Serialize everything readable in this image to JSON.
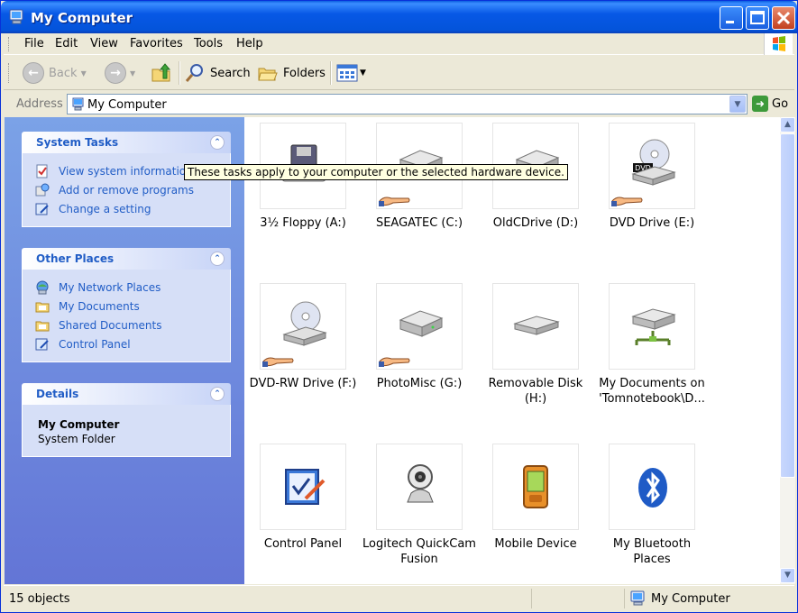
{
  "window": {
    "title": "My Computer"
  },
  "menu": {
    "items": [
      "File",
      "Edit",
      "View",
      "Favorites",
      "Tools",
      "Help"
    ]
  },
  "toolbar": {
    "back": "Back",
    "search": "Search",
    "folders": "Folders"
  },
  "address": {
    "label": "Address",
    "value": "My Computer",
    "go": "Go"
  },
  "system_tasks": {
    "title": "System Tasks",
    "items": [
      "View system information",
      "Add or remove programs",
      "Change a setting"
    ]
  },
  "other_places": {
    "title": "Other Places",
    "items": [
      "My Network Places",
      "My Documents",
      "Shared Documents",
      "Control Panel"
    ]
  },
  "details": {
    "title": "Details",
    "name": "My Computer",
    "type": "System Folder"
  },
  "tooltip": "These tasks apply to your computer or the selected hardware device.",
  "items": [
    {
      "label": "3½ Floppy (A:)",
      "icon": "floppy-drive-icon"
    },
    {
      "label": "SEAGATEC (C:)",
      "icon": "hard-drive-icon"
    },
    {
      "label": "OldCDrive (D:)",
      "icon": "hard-drive-icon"
    },
    {
      "label": "DVD Drive (E:)",
      "icon": "dvd-drive-icon"
    },
    {
      "label": "DVD-RW Drive (F:)",
      "icon": "dvd-drive-icon"
    },
    {
      "label": "PhotoMisc (G:)",
      "icon": "hard-drive-icon"
    },
    {
      "label": "Removable Disk (H:)",
      "icon": "removable-disk-icon"
    },
    {
      "label": "My Documents on 'Tomnotebook\\D...",
      "icon": "network-drive-icon"
    },
    {
      "label": "Control Panel",
      "icon": "control-panel-icon"
    },
    {
      "label": "Logitech QuickCam Fusion",
      "icon": "webcam-icon"
    },
    {
      "label": "Mobile Device",
      "icon": "mobile-device-icon"
    },
    {
      "label": "My Bluetooth Places",
      "icon": "bluetooth-icon"
    }
  ],
  "status": {
    "count": "15 objects",
    "location": "My Computer"
  },
  "colors": {
    "title_blue": "#0454da",
    "task_blue": "#215dc6",
    "pane_gradient_top": "#7ba2e7",
    "pane_gradient_bottom": "#6375d6"
  }
}
